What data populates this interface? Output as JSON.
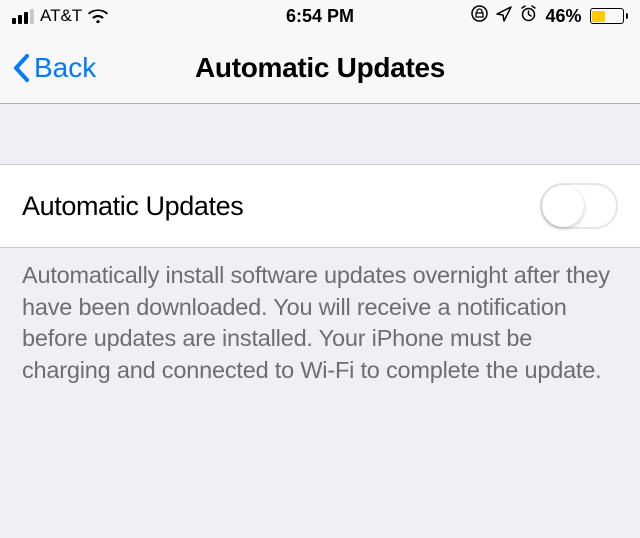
{
  "status": {
    "carrier": "AT&T",
    "time": "6:54 PM",
    "battery_percent": "46%",
    "battery_level": 46,
    "battery_color": "#ffcc00"
  },
  "nav": {
    "back_label": "Back",
    "title": "Automatic Updates"
  },
  "settings_row": {
    "label": "Automatic Updates",
    "toggle_on": false
  },
  "footer": {
    "text": "Automatically install software updates overnight after they have been downloaded. You will receive a notification before updates are installed. Your iPhone must be charging and connected to Wi-Fi to complete the update."
  }
}
